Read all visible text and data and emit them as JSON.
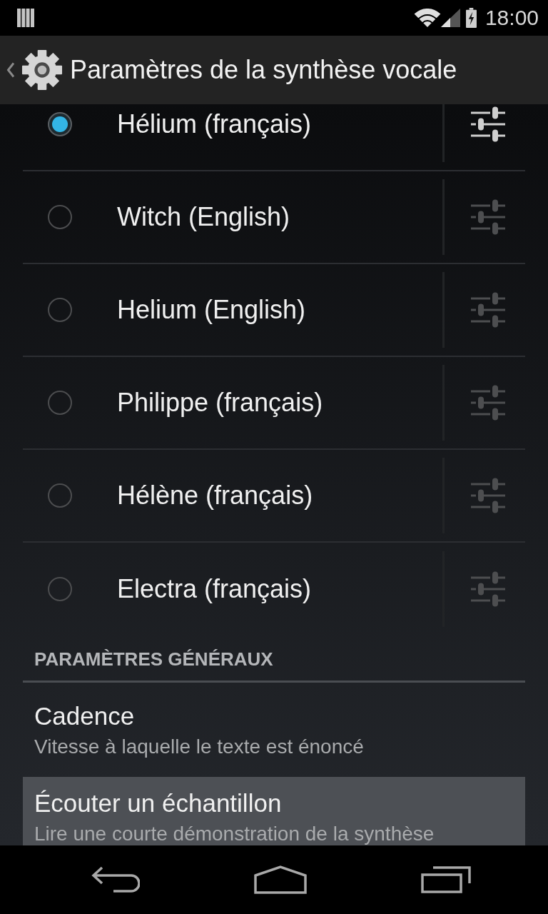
{
  "status_bar": {
    "time": "18:00"
  },
  "action_bar": {
    "title": "Paramètres de la synthèse vocale"
  },
  "voices": [
    {
      "name": "Hélium (français)",
      "selected": true
    },
    {
      "name": "Witch (English)",
      "selected": false
    },
    {
      "name": "Helium (English)",
      "selected": false
    },
    {
      "name": "Philippe (français)",
      "selected": false
    },
    {
      "name": "Hélène (français)",
      "selected": false
    },
    {
      "name": "Electra (français)",
      "selected": false
    }
  ],
  "general_settings": {
    "header": "PARAMÈTRES GÉNÉRAUX",
    "items": [
      {
        "title": "Cadence",
        "summary": "Vitesse à laquelle le texte est énoncé",
        "pressed": false
      },
      {
        "title": "Écouter un échantillon",
        "summary": "Lire une courte démonstration de la synthèse",
        "pressed": true
      }
    ]
  }
}
